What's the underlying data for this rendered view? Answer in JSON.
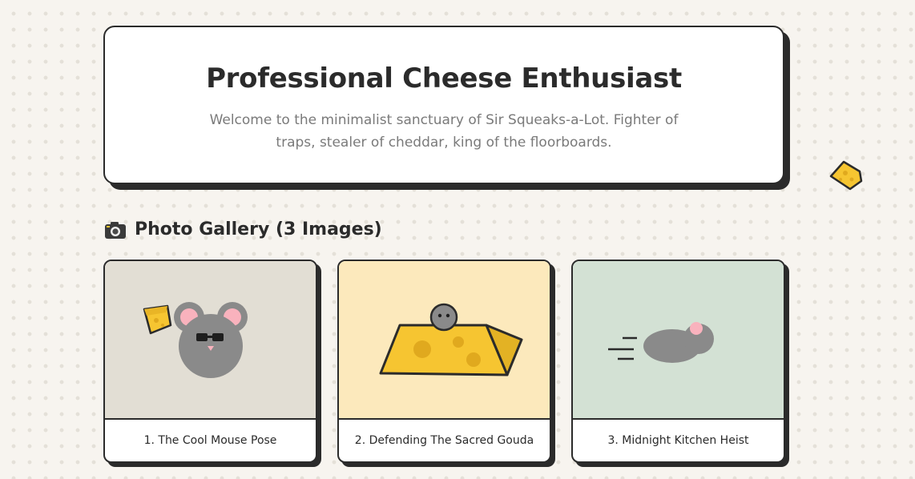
{
  "hero": {
    "title": "Professional Cheese Enthusiast",
    "description": "Welcome to the minimalist sanctuary of Sir Squeaks-a-Lot. Fighter of traps, stealer of cheddar, king of the floorboards."
  },
  "gallery": {
    "heading_icon": "camera-icon",
    "heading": "Photo Gallery (3 Images)",
    "cards": [
      {
        "caption": "1. The Cool Mouse Pose",
        "background": "#e2ded4"
      },
      {
        "caption": "2. Defending The Sacred Gouda",
        "background": "#fce9bc"
      },
      {
        "caption": "3. Midnight Kitchen Heist",
        "background": "#d3e1d4"
      }
    ]
  },
  "colors": {
    "background": "#f7f4ef",
    "ink": "#2b2b2b",
    "cheese": "#f6c531",
    "mouse": "#8a8a8a",
    "pink": "#f9b2bd"
  }
}
